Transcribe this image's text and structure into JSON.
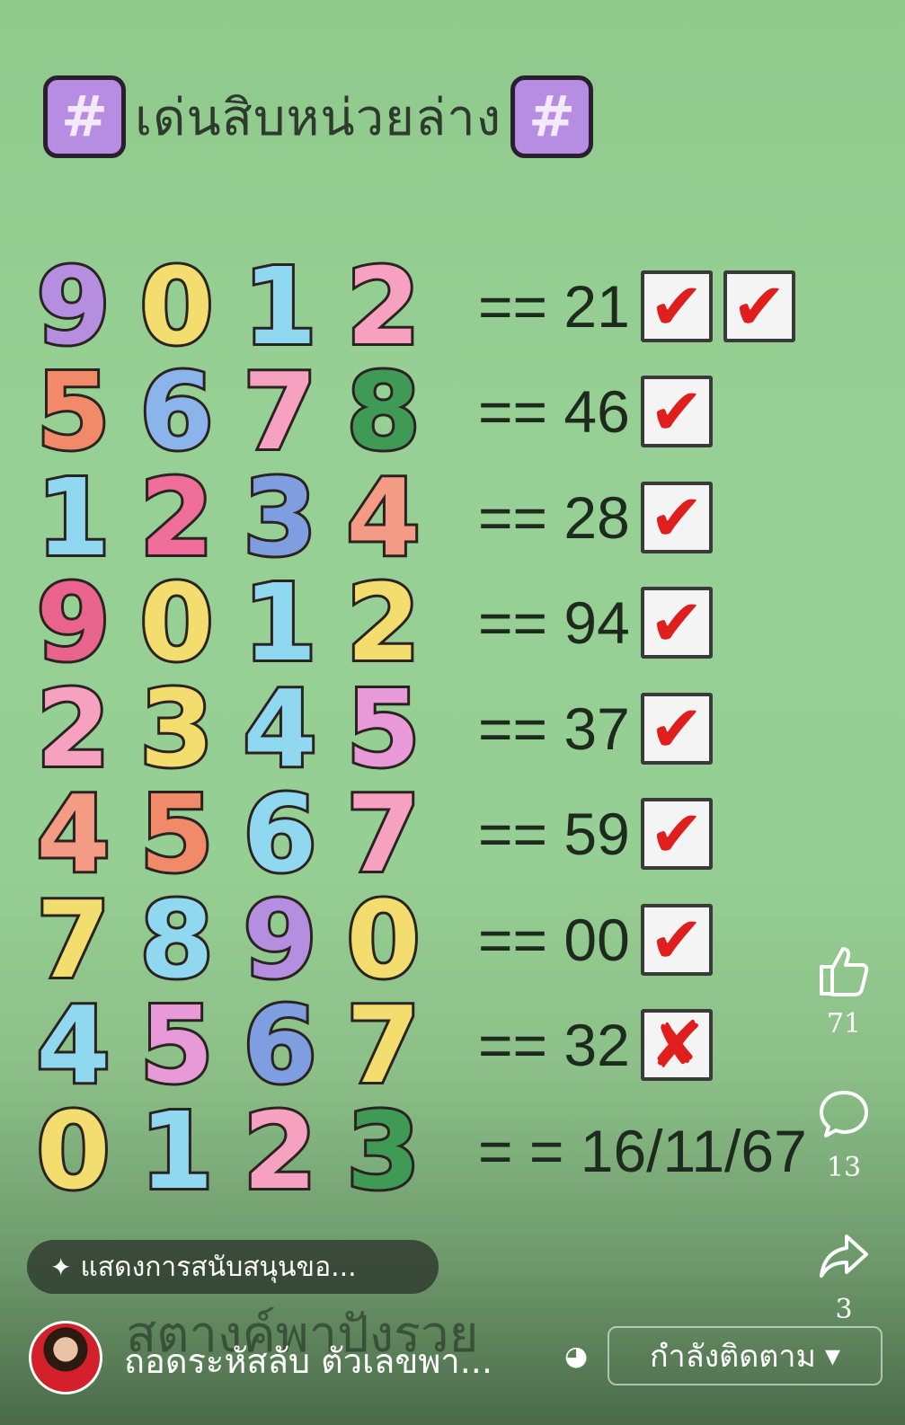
{
  "title": {
    "text": "เด่นสิบหน่วยล่าง",
    "hash_symbol": "#"
  },
  "rows": [
    {
      "digits": [
        "9",
        "0",
        "1",
        "2"
      ],
      "colors": [
        "#b58ee0",
        "#f3dd6e",
        "#8fd8ef",
        "#f5a1bf"
      ],
      "result": "== 21",
      "marks": [
        "✔",
        "✔"
      ]
    },
    {
      "digits": [
        "5",
        "6",
        "7",
        "8"
      ],
      "colors": [
        "#f08a68",
        "#8ab4ea",
        "#f5a1bf",
        "#3f9a55"
      ],
      "result": "== 46",
      "marks": [
        "✔"
      ]
    },
    {
      "digits": [
        "1",
        "2",
        "3",
        "4"
      ],
      "colors": [
        "#8fd8ef",
        "#ef6f9a",
        "#7e9ee0",
        "#f39b84"
      ],
      "result": "== 28",
      "marks": [
        "✔"
      ]
    },
    {
      "digits": [
        "9",
        "0",
        "1",
        "2"
      ],
      "colors": [
        "#e8648c",
        "#f3dd6e",
        "#8fd8ef",
        "#f3dd6e"
      ],
      "result": "== 94",
      "marks": [
        "✔"
      ]
    },
    {
      "digits": [
        "2",
        "3",
        "4",
        "5"
      ],
      "colors": [
        "#f5a1bf",
        "#f3dd6e",
        "#8fd8ef",
        "#e89ad8"
      ],
      "result": "== 37",
      "marks": [
        "✔"
      ]
    },
    {
      "digits": [
        "4",
        "5",
        "6",
        "7"
      ],
      "colors": [
        "#f39b84",
        "#f08a68",
        "#8fd8ef",
        "#f5a1bf"
      ],
      "result": "== 59",
      "marks": [
        "✔"
      ]
    },
    {
      "digits": [
        "7",
        "8",
        "9",
        "0"
      ],
      "colors": [
        "#f3dd6e",
        "#8fd8ef",
        "#b58ee0",
        "#f3dd6e"
      ],
      "result": "== 00",
      "marks": [
        "✔"
      ]
    },
    {
      "digits": [
        "4",
        "5",
        "6",
        "7"
      ],
      "colors": [
        "#8fd8ef",
        "#e89ad8",
        "#7e9ee0",
        "#f3dd6e"
      ],
      "result": "== 32",
      "marks": [
        "✘"
      ]
    },
    {
      "digits": [
        "0",
        "1",
        "2",
        "3"
      ],
      "colors": [
        "#f3dd6e",
        "#8fd8ef",
        "#f5a1bf",
        "#3f9a55"
      ],
      "result": "= = 16/11/67",
      "marks": []
    }
  ],
  "actions": {
    "like": {
      "icon": "thumbs-up-icon",
      "count": "71"
    },
    "comment": {
      "icon": "comment-icon",
      "count": "13"
    },
    "share": {
      "icon": "share-icon",
      "count": "3"
    }
  },
  "support_label": "แสดงการสนับสนุนขอ...",
  "overlay_text": "สตางค์พาปังรวย",
  "channel_name": "ถอดระหัสลับ ตัวเลขพา...",
  "follow_label": "กำลังติดตาม"
}
